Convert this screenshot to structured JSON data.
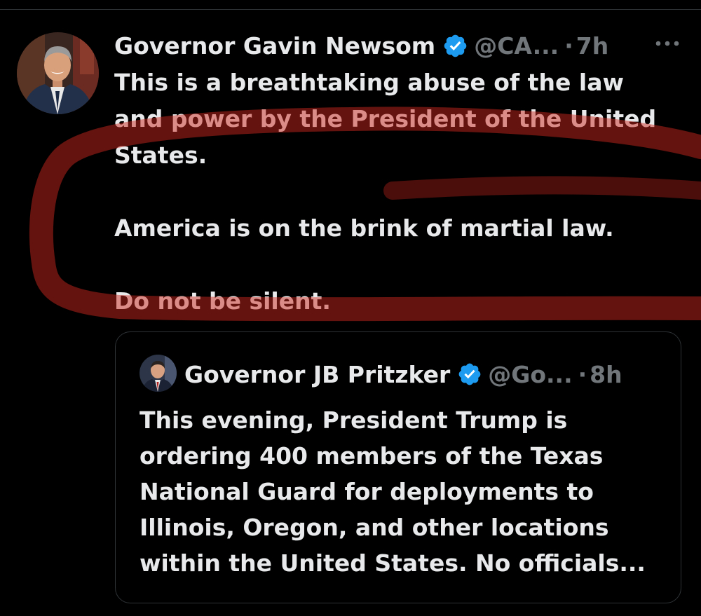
{
  "tweet": {
    "display_name": "Governor Gavin Newsom",
    "handle": "@CA...",
    "separator": "·",
    "time": "7h",
    "more_icon": "more-horizontal-icon",
    "verified_icon": "verified-badge-icon",
    "lines": [
      "This is a breathtaking abuse of the law",
      "and power by the President of the United",
      "States."
    ],
    "line_4": "America is on the brink of martial law.",
    "line_5": "Do not be silent."
  },
  "quoted_tweet": {
    "display_name": "Governor JB Pritzker",
    "handle": "@Go...",
    "separator": "·",
    "time": "8h",
    "verified_icon": "verified-badge-icon",
    "lines": [
      "This evening, President Trump is",
      "ordering 400 members of the Texas",
      "National Guard for deployments to",
      "Illinois, Oregon, and other locations",
      "within the United States. No officials..."
    ]
  },
  "colors": {
    "background": "#000000",
    "text": "#e7e9ea",
    "secondary_text": "#71767b",
    "border": "#2f3336",
    "verified_blue": "#1d9bf0",
    "annotation_red": "#d0281e"
  }
}
